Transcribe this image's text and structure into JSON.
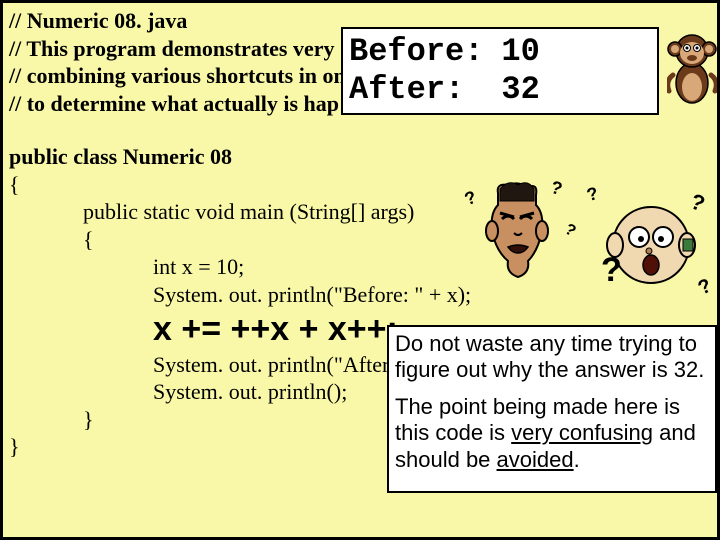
{
  "comments": {
    "l1": "// Numeric 08. java",
    "l2": "// This program demonstrates very",
    "l3": "// combining various shortcuts in on",
    "l4": "// to determine what actually is hap"
  },
  "code": {
    "class_decl": "public class Numeric 08",
    "open1": "{",
    "main_decl": "public static void main (String[] args)",
    "open2": "{",
    "decl_x": "int x = 10;",
    "print_before": "System. out. println(\"Before: \" + x);",
    "big_expr": "x += ++x + x++;",
    "print_after": "System. out. println(\"After: \" + x);",
    "print_blank": "System. out. println();",
    "close2": "}",
    "close1": "}"
  },
  "output": {
    "before_label": "Before:",
    "before_val": "10",
    "after_label": "After:",
    "after_val": "32"
  },
  "note": {
    "p1a": "Do not waste any time trying to figure out why the answer is 32.",
    "p2a": "The point being made here is this code is ",
    "p2b": "very confusing",
    "p2c": " and should be ",
    "p2d": "avoided",
    "p2e": "."
  },
  "decor": {
    "q": "?"
  }
}
